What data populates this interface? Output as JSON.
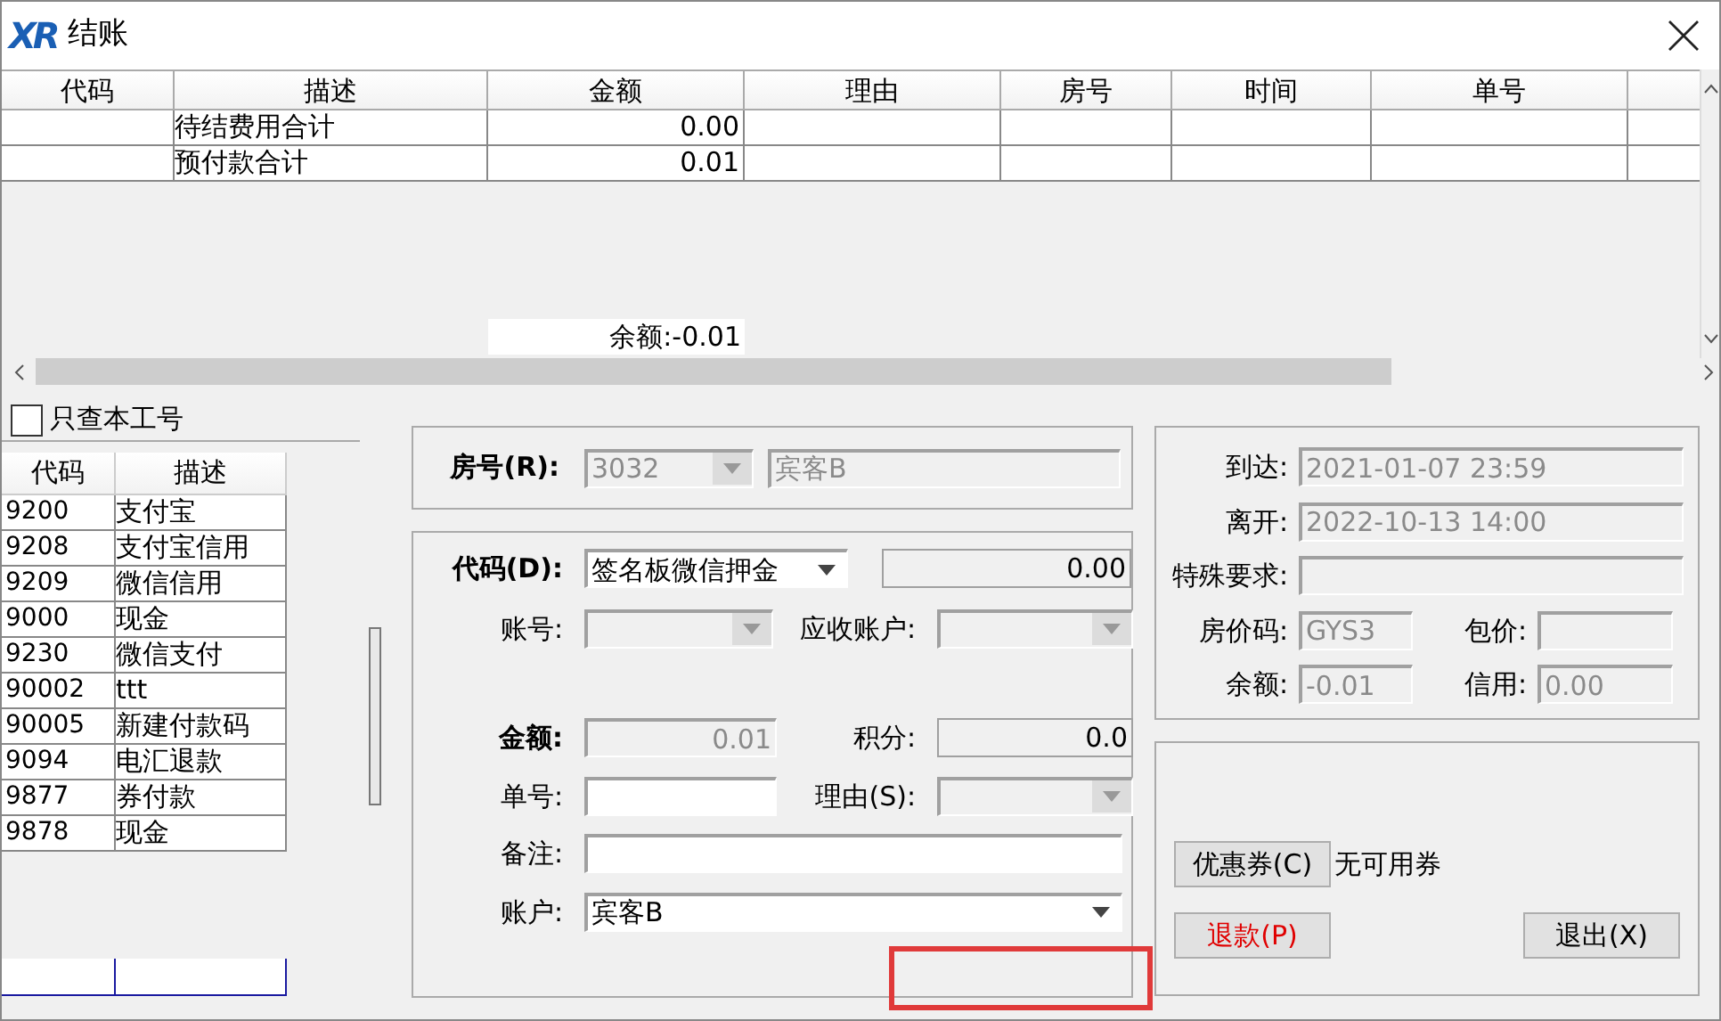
{
  "window": {
    "logo": "XR",
    "title": "结账"
  },
  "charges_table": {
    "columns": [
      "代码",
      "描述",
      "金额",
      "理由",
      "房号",
      "时间",
      "单号"
    ],
    "rows": [
      {
        "description": "待结费用合计",
        "amount": "0.00"
      },
      {
        "description": "预付款合计",
        "amount": "0.01"
      }
    ],
    "balance": "余额:-0.01"
  },
  "filter": {
    "label": "只查本工号",
    "checked": false
  },
  "codes_table": {
    "columns": [
      "代码",
      "描述"
    ],
    "rows": [
      {
        "code": "9200",
        "description": "支付宝"
      },
      {
        "code": "9208",
        "description": "支付宝信用"
      },
      {
        "code": "9209",
        "description": "微信信用"
      },
      {
        "code": "9000",
        "description": "现金"
      },
      {
        "code": "9230",
        "description": "微信支付"
      },
      {
        "code": "90002",
        "description": "ttt"
      },
      {
        "code": "90005",
        "description": "新建付款码"
      },
      {
        "code": "9094",
        "description": "电汇退款"
      },
      {
        "code": "9877",
        "description": "券付款"
      },
      {
        "code": "9878",
        "description": "现金"
      }
    ]
  },
  "room": {
    "label": "房号(R):",
    "number": {
      "kind": "combo",
      "value": "3032",
      "disabled": true
    },
    "guest": {
      "kind": "text",
      "value": "宾客B",
      "disabled": true
    }
  },
  "payment": {
    "code": {
      "label": "代码(D):",
      "bold": true,
      "kind": "combo",
      "value": "签名板微信押金",
      "disabled": false
    },
    "code_amount": {
      "kind": "readonly",
      "value": "0.00",
      "disabled": false
    },
    "account_no": {
      "label": "账号:",
      "bold": false,
      "kind": "combo",
      "disabled": true
    },
    "receivable": {
      "label": "应收账户:",
      "bold": false,
      "kind": "combo",
      "disabled": true
    },
    "amount": {
      "label": "金额:",
      "bold": true,
      "kind": "text",
      "value": "0.01",
      "disabled": true
    },
    "points": {
      "label": "积分:",
      "bold": false,
      "kind": "readonly",
      "value": "0.0",
      "disabled": false
    },
    "doc_no": {
      "label": "单号:",
      "bold": false,
      "kind": "text",
      "disabled": false
    },
    "reason": {
      "label": "理由(S):",
      "bold": false,
      "kind": "combo",
      "disabled": true
    },
    "remark": {
      "label": "备注:",
      "bold": false,
      "kind": "text",
      "disabled": false
    },
    "account": {
      "label": "账户:",
      "bold": false,
      "kind": "combo",
      "value": "宾客B",
      "disabled": false
    }
  },
  "stay": {
    "arrival": {
      "label": "到达:",
      "kind": "text",
      "value": "2021-01-07 23:59",
      "disabled": true
    },
    "departure": {
      "label": "离开:",
      "kind": "text",
      "value": "2022-10-13 14:00",
      "disabled": true
    },
    "special": {
      "label": "特殊要求:",
      "kind": "text",
      "disabled": true
    },
    "rate_code": {
      "label": "房价码:",
      "kind": "text",
      "value": "GYS3",
      "disabled": true
    },
    "package": {
      "label": "包价:",
      "kind": "text",
      "disabled": true
    },
    "balance": {
      "label": "余额:",
      "kind": "text",
      "value": "-0.01",
      "disabled": true
    },
    "credit": {
      "label": "信用:",
      "kind": "text",
      "value": "0.00",
      "disabled": true
    }
  },
  "coupon": {
    "button": "优惠券(C)",
    "note": "无可用券"
  },
  "buttons": [
    {
      "label": "退款(P)",
      "kind": "danger"
    },
    {
      "label": "退出(X)",
      "kind": "normal"
    }
  ]
}
